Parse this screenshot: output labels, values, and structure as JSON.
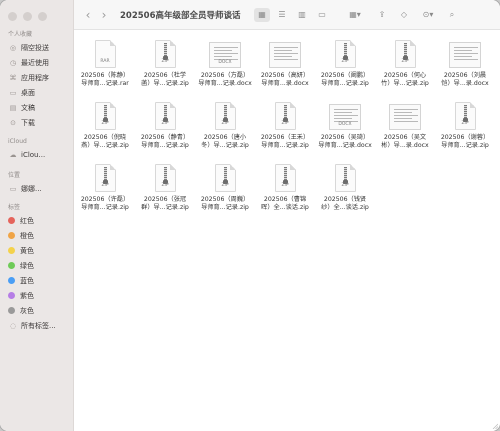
{
  "window": {
    "title": "202506高年级部全员导师谈话"
  },
  "sidebar": {
    "favorites_title": "个人收藏",
    "favorites": [
      {
        "label": "隔空投送",
        "icon": "airdrop-icon",
        "glyph": "◎"
      },
      {
        "label": "最近使用",
        "icon": "clock-icon",
        "glyph": "◷"
      },
      {
        "label": "应用程序",
        "icon": "applications-icon",
        "glyph": "⌘"
      },
      {
        "label": "桌面",
        "icon": "desktop-icon",
        "glyph": "▭"
      },
      {
        "label": "文稿",
        "icon": "documents-icon",
        "glyph": "▤"
      },
      {
        "label": "下载",
        "icon": "downloads-icon",
        "glyph": "⊙"
      }
    ],
    "icloud_title": "iCloud",
    "icloud": [
      {
        "label": "iClou...",
        "icon": "icloud-icon",
        "glyph": "☁"
      }
    ],
    "locations_title": "位置",
    "locations": [
      {
        "label": "娜娜...",
        "icon": "computer-icon",
        "glyph": "▭"
      }
    ],
    "tags_title": "标签",
    "tags": [
      {
        "label": "红色",
        "color": "#e5645c"
      },
      {
        "label": "橙色",
        "color": "#f0a446"
      },
      {
        "label": "黄色",
        "color": "#f4d24b"
      },
      {
        "label": "绿色",
        "color": "#6fcb58"
      },
      {
        "label": "蓝色",
        "color": "#4a9ef5"
      },
      {
        "label": "紫色",
        "color": "#b67ee6"
      },
      {
        "label": "灰色",
        "color": "#9a9a9a"
      },
      {
        "label": "所有标签...",
        "icon": "all-tags-icon",
        "glyph": "◌"
      }
    ]
  },
  "files": [
    {
      "line1": "202506（陈静）",
      "line2": "导师育...记录.rar",
      "type": "rar",
      "tag": "RAR"
    },
    {
      "line1": "202506（杜学",
      "line2": "菡）导...记录.zip",
      "type": "zip",
      "tag": "ZIP"
    },
    {
      "line1": "202506（方磊）",
      "line2": "导师育...记录.docx",
      "type": "docx",
      "tag": "DOCX"
    },
    {
      "line1": "202506（高妍）",
      "line2": "导师育...录.docx",
      "type": "docx",
      "tag": ""
    },
    {
      "line1": "202506（阚鹏）",
      "line2": "导师育...记录.zip",
      "type": "zip",
      "tag": "ZIP"
    },
    {
      "line1": "202506（何心",
      "line2": "竹）导...记录.zip",
      "type": "zip",
      "tag": "ZIP"
    },
    {
      "line1": "202506（刘晨",
      "line2": "恺）导...录.docx",
      "type": "docx",
      "tag": ""
    },
    {
      "line1": "202506（倪晓",
      "line2": "燕）导...记录.zip",
      "type": "zip",
      "tag": "ZIP"
    },
    {
      "line1": "202506（静青）",
      "line2": "导师育...记录.zip",
      "type": "zip",
      "tag": "ZIP"
    },
    {
      "line1": "202506（唐小",
      "line2": "冬）导...记录.zip",
      "type": "zip",
      "tag": "ZIP"
    },
    {
      "line1": "202506（王禾）",
      "line2": "导师育...记录.zip",
      "type": "zip",
      "tag": "ZIP"
    },
    {
      "line1": "202506（吴琦）",
      "line2": "导师育...记录.docx",
      "type": "docx",
      "tag": "DOCX"
    },
    {
      "line1": "202506（吴文",
      "line2": "彬）导...录.docx",
      "type": "docx",
      "tag": ""
    },
    {
      "line1": "202506（谢蓉）",
      "line2": "导师育...记录.zip",
      "type": "zip",
      "tag": "ZIP"
    },
    {
      "line1": "202506（许磊）",
      "line2": "导师育...记录.zip",
      "type": "zip",
      "tag": "ZIP"
    },
    {
      "line1": "202506（张冠",
      "line2": "群）导...记录.zip",
      "type": "zip",
      "tag": "ZIP"
    },
    {
      "line1": "202506（周巍）",
      "line2": "导师育...记录.zip",
      "type": "zip",
      "tag": "ZIP"
    },
    {
      "line1": "202506（曹锦",
      "line2": "晖）全...谈话.zip",
      "type": "zip",
      "tag": "ZIP"
    },
    {
      "line1": "202506（钱贤",
      "line2": "纱）全...谈话.zip",
      "type": "zip",
      "tag": "ZIP"
    }
  ]
}
